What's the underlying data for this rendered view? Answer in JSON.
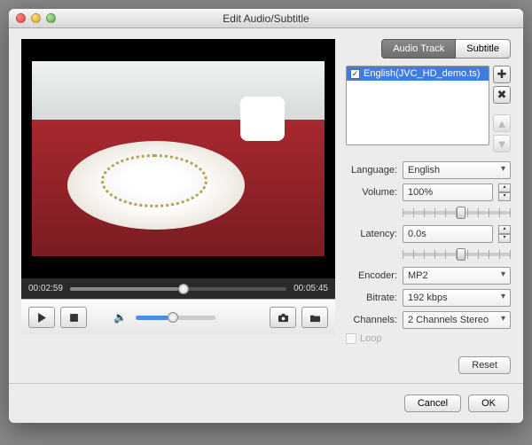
{
  "window": {
    "title": "Edit Audio/Subtitle"
  },
  "tabs": {
    "audio": "Audio Track",
    "subtitle": "Subtitle"
  },
  "tracklist": {
    "items": [
      {
        "checked": true,
        "label": "English(JVC_HD_demo.ts)"
      }
    ]
  },
  "player": {
    "current": "00:02:59",
    "duration": "00:05:45"
  },
  "form": {
    "language_label": "Language:",
    "language_value": "English",
    "volume_label": "Volume:",
    "volume_value": "100%",
    "latency_label": "Latency:",
    "latency_value": "0.0s",
    "encoder_label": "Encoder:",
    "encoder_value": "MP2",
    "bitrate_label": "Bitrate:",
    "bitrate_value": "192 kbps",
    "channels_label": "Channels:",
    "channels_value": "2 Channels Stereo",
    "loop_label": "Loop"
  },
  "buttons": {
    "reset": "Reset",
    "cancel": "Cancel",
    "ok": "OK"
  },
  "icons": {
    "add": "✚",
    "remove": "✖",
    "up": "▲",
    "down": "▼",
    "check": "✓",
    "spin_up": "▴",
    "spin_down": "▾"
  }
}
